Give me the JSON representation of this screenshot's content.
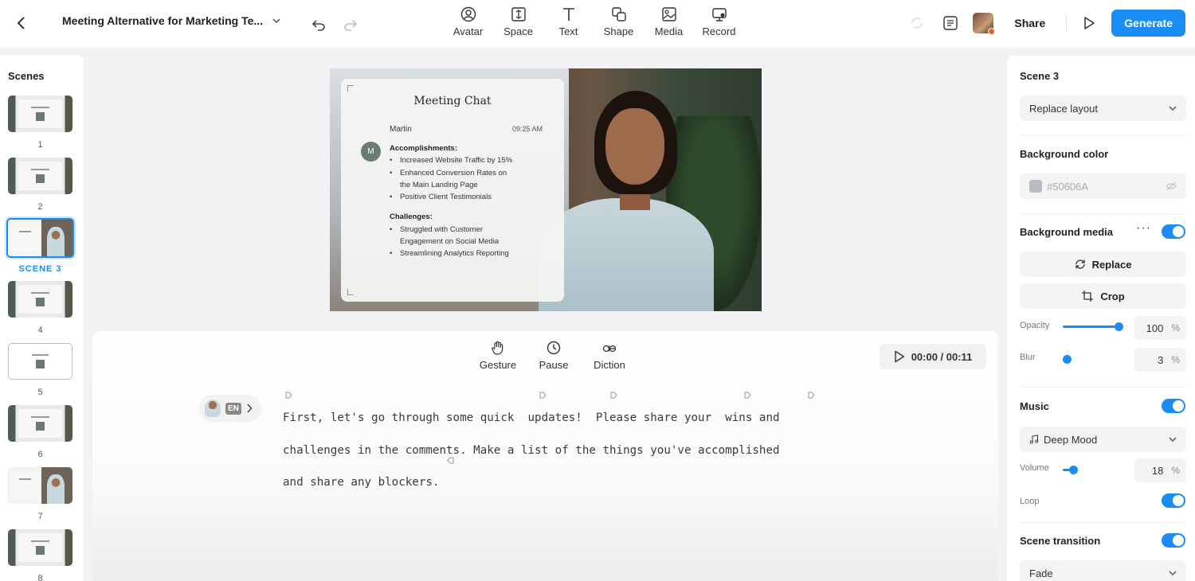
{
  "topbar": {
    "project_title": "Meeting Alternative for Marketing Te...",
    "tools": [
      "Avatar",
      "Space",
      "Text",
      "Shape",
      "Media",
      "Record"
    ],
    "share_label": "Share",
    "generate_label": "Generate"
  },
  "scenes": {
    "title": "Scenes",
    "numbers": [
      "1",
      "2",
      "SCENE 3",
      "4",
      "5",
      "6",
      "7",
      "8"
    ],
    "active_index": 2
  },
  "canvas": {
    "chat": {
      "title": "Meeting Chat",
      "name": "Martin",
      "time": "09:25 AM",
      "avatar_letter": "M",
      "accomplishments_heading": "Accomplishments:",
      "accomplishments": [
        "Increased Website Traffic by 15%",
        "Enhanced Conversion Rates on the Main Landing Page",
        "Positive Client Testimonials"
      ],
      "challenges_heading": "Challenges:",
      "challenges": [
        "Struggled with Customer Engagement on Social Media",
        "Streamlining Analytics Reporting"
      ]
    }
  },
  "editor": {
    "tools": [
      "Gesture",
      "Pause",
      "Diction"
    ],
    "timer": "00:00 / 00:11",
    "lang": "EN",
    "script_lines": [
      "First, let's go through some quick  updates!  Please share your  wins and",
      "challenges in the comments. Make a list of the things you've accomplished",
      "and share any blockers."
    ]
  },
  "panel": {
    "scene_title": "Scene 3",
    "layout_label": "Replace layout",
    "bg_color_heading": "Background color",
    "bg_color_value": "#50606A",
    "bg_media_heading": "Background media",
    "replace_label": "Replace",
    "crop_label": "Crop",
    "opacity_label": "Opacity",
    "opacity_value": "100",
    "opacity_fraction": 1.0,
    "blur_label": "Blur",
    "blur_value": "3",
    "blur_fraction": 0.03,
    "music_heading": "Music",
    "music_track": "Deep Mood",
    "volume_label": "Volume",
    "volume_value": "18",
    "volume_fraction": 0.18,
    "loop_label": "Loop",
    "transition_heading": "Scene transition",
    "transition_value": "Fade",
    "percent_sign": "%"
  },
  "colors": {
    "accent": "#1a8df5",
    "bg_swatch": "#50606A"
  }
}
